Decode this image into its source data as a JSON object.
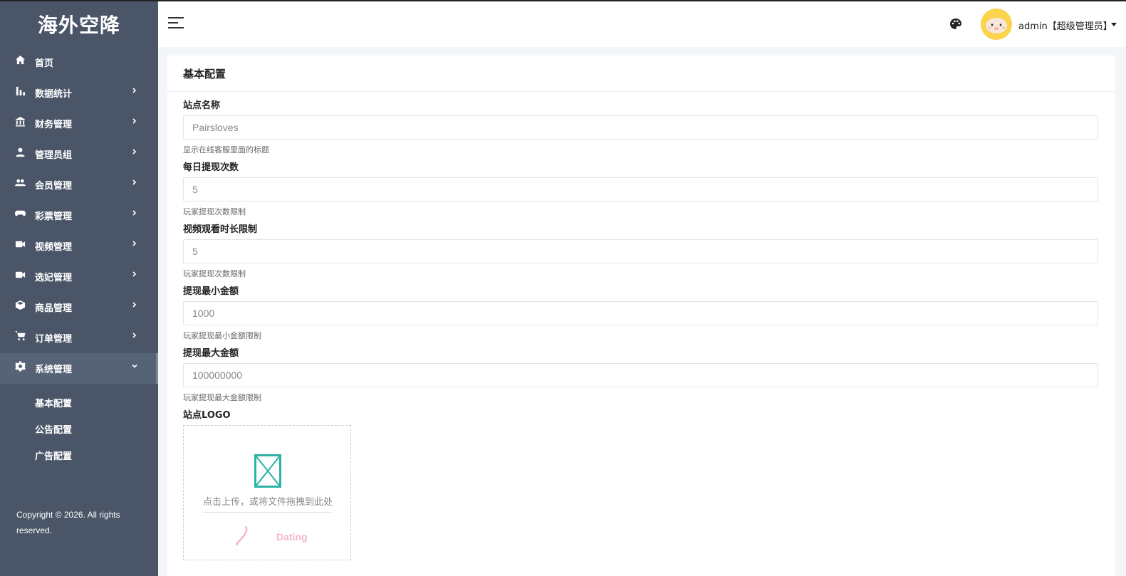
{
  "app": {
    "title": "海外空降"
  },
  "sidebar": {
    "items": [
      {
        "label": "首页",
        "icon": "home-icon"
      },
      {
        "label": "数据统计",
        "icon": "bar-chart-icon"
      },
      {
        "label": "财务管理",
        "icon": "bank-icon"
      },
      {
        "label": "管理员组",
        "icon": "user-icon"
      },
      {
        "label": "会员管理",
        "icon": "group-icon"
      },
      {
        "label": "彩票管理",
        "icon": "gamepad-icon"
      },
      {
        "label": "视频管理",
        "icon": "video-icon"
      },
      {
        "label": "选妃管理",
        "icon": "video-icon"
      },
      {
        "label": "商品管理",
        "icon": "box-icon"
      },
      {
        "label": "订单管理",
        "icon": "cart-icon"
      },
      {
        "label": "系统管理",
        "icon": "gear-icon"
      }
    ],
    "submenu": [
      {
        "label": "基本配置"
      },
      {
        "label": "公告配置"
      },
      {
        "label": "广告配置"
      }
    ],
    "copyright": "Copyright © 2026. All rights reserved."
  },
  "header": {
    "user": "admin【超级管理员】",
    "icons": [
      "menu-icon",
      "palette-icon",
      "caret-down-icon"
    ]
  },
  "main": {
    "card_title": "基本配置",
    "fields": [
      {
        "label": "站点名称",
        "value": "Pairsloves",
        "help": "显示在线客服里面的标题"
      },
      {
        "label": "每日提现次数",
        "value": "5",
        "help": "玩家提现次数限制"
      },
      {
        "label": "视频观看时长限制",
        "value": "5",
        "help": "玩家提现次数限制"
      },
      {
        "label": "提现最小金额",
        "value": "1000",
        "help": "玩家提现最小金额限制"
      },
      {
        "label": "提现最大金额",
        "value": "100000000",
        "help": "玩家提现最大金额限制"
      }
    ],
    "logo": {
      "label": "站点LOGO",
      "upload_text": "点击上传，或将文件拖拽到此处",
      "preview_text": "Dating"
    }
  },
  "colors": {
    "sidebar": "#4a5568",
    "sidebar_active": "#566275",
    "accent": "#2bb3a8",
    "avatar": "#fcd34d"
  }
}
